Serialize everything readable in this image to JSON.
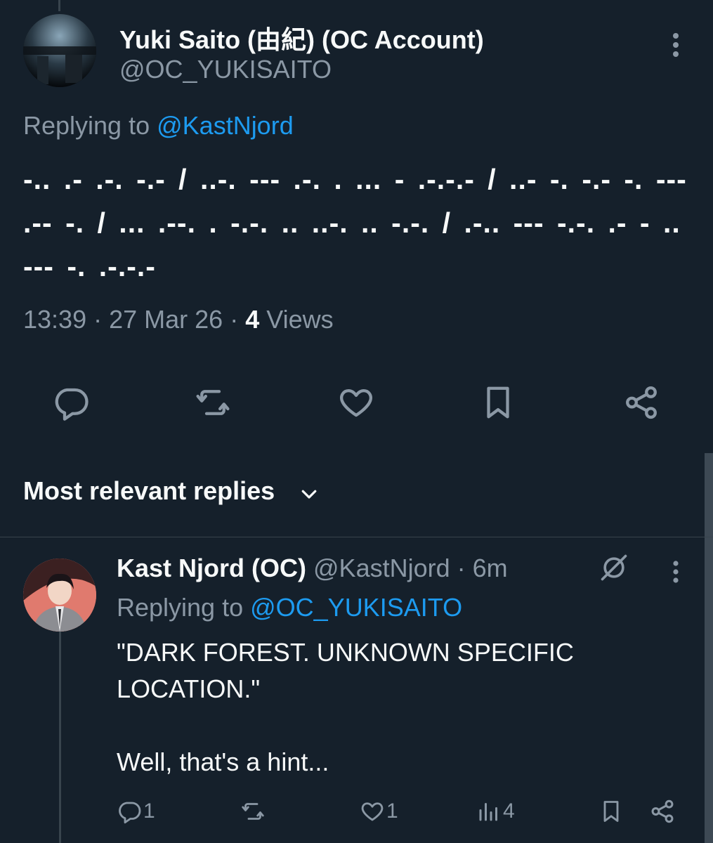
{
  "tweet": {
    "author_name": "Yuki Saito (由紀) (OC Account)",
    "author_handle": "@OC_YUKISAITO",
    "replying_prefix": "Replying to ",
    "replying_handle": "@KastNjord",
    "morse_text": "-.. .- .-. -.- / ..-. --- .-. . ... - .-.-.- / ..- -. -.- -. --- .-- -. / ... .--. . -.-. .. ..-. .. -.-. / .-.. --- -.-. .- - .. --- -. .-.-.-",
    "time": "13:39",
    "separator": " · ",
    "date": "27 Mar 26",
    "views_count": "4",
    "views_label": " Views"
  },
  "sort": {
    "label": "Most relevant replies"
  },
  "reply": {
    "author_name": "Kast Njord (OC)",
    "author_handle": "@KastNjord",
    "time": "· 6m",
    "replying_prefix": "Replying to ",
    "replying_handle": "@OC_YUKISAITO",
    "text_line1": "\"DARK FOREST. UNKNOWN SPECIFIC LOCATION.\"",
    "text_line2": "Well, that's a hint...",
    "reply_count": "1",
    "like_count": "1",
    "view_count": "4"
  },
  "colors": {
    "background": "#15202b",
    "text": "#f7f9f9",
    "muted": "#8b98a5",
    "link": "#1d9bf0",
    "divider": "#38444d"
  },
  "icons": {
    "more": "more-vertical-icon",
    "reply": "reply-icon",
    "retweet": "retweet-icon",
    "like": "heart-icon",
    "bookmark": "bookmark-icon",
    "share": "share-icon",
    "views": "bar-chart-icon",
    "grok": "grok-icon",
    "chevron": "chevron-down-icon"
  }
}
